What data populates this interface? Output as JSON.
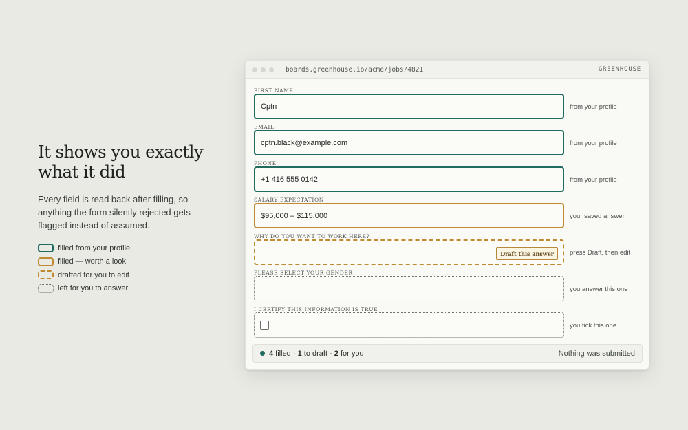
{
  "intro": {
    "headline": "It shows you exactly what it did",
    "body": "Every field is read back after filling, so anything the form silently rejected gets flagged instead of assumed."
  },
  "legend": [
    {
      "label": "filled from your profile"
    },
    {
      "label": "filled — worth a look"
    },
    {
      "label": "drafted for you to edit"
    },
    {
      "label": "left for you to answer"
    }
  ],
  "colors": {
    "profile": "#1f6b5f",
    "look": "#c08a32",
    "left": "#6e746f",
    "background": "#e9eae4"
  },
  "window": {
    "url": "boards.greenhouse.io/acme/jobs/4821",
    "brand": "GREENHOUSE"
  },
  "fields": [
    {
      "label": "FIRST NAME",
      "value": "Cptn",
      "note": "from your profile",
      "status": "profile"
    },
    {
      "label": "EMAIL",
      "value": "cptn.black@example.com",
      "note": "from your profile",
      "status": "profile"
    },
    {
      "label": "PHONE",
      "value": "+1 416 555 0142",
      "note": "from your profile",
      "status": "profile"
    },
    {
      "label": "SALARY EXPECTATION",
      "value": "$95,000 – $115,000",
      "note": "your saved answer",
      "status": "look"
    },
    {
      "label": "WHY DO YOU WANT TO WORK HERE?",
      "value": "",
      "note": "press Draft, then edit",
      "status": "draft",
      "button": "Draft this answer"
    },
    {
      "label": "PLEASE SELECT YOUR GENDER",
      "value": "",
      "note": "you answer this one",
      "status": "left"
    },
    {
      "label": "I CERTIFY THIS INFORMATION IS TRUE",
      "value": "",
      "note": "you tick this one",
      "status": "left",
      "checked": false
    }
  ],
  "status": {
    "filled_count": "4",
    "filled_text": " filled · ",
    "draft_count": "1",
    "draft_text": " to draft · ",
    "you_count": "2",
    "you_text": " for you",
    "submitted": "Nothing was submitted"
  }
}
